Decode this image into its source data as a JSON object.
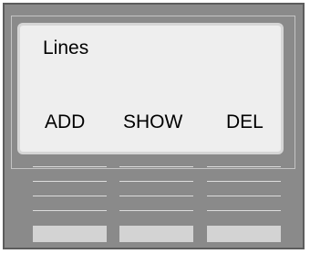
{
  "screen": {
    "title": "Lines",
    "softkeys": [
      {
        "label": "ADD"
      },
      {
        "label": "SHOW"
      },
      {
        "label": "DEL"
      }
    ]
  },
  "colors": {
    "device_body": "#8a8a8a",
    "screen_background": "#eeeeee",
    "key_button": "#d3d3d3",
    "grille_line": "#dcdcdc"
  }
}
